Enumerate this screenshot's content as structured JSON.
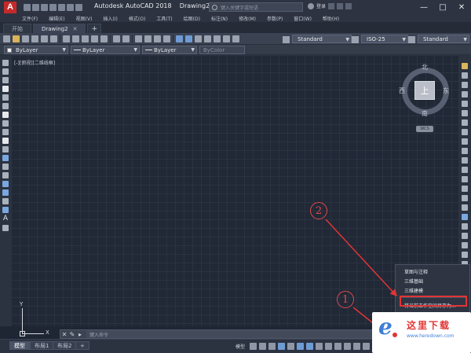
{
  "titlebar": {
    "app_name": "Autodesk AutoCAD 2018",
    "file_name": "Drawing2.dwg",
    "search_placeholder": "键入关键字或短语",
    "login_label": "登录",
    "logo_letter": "A"
  },
  "menu": {
    "items": [
      "文件(F)",
      "编辑(E)",
      "视图(V)",
      "插入(I)",
      "格式(O)",
      "工具(T)",
      "绘图(D)",
      "标注(N)",
      "修改(M)",
      "参数(P)",
      "窗口(W)",
      "帮助(H)"
    ],
    "window_controls": [
      "—",
      "□",
      "✕"
    ]
  },
  "tabs": {
    "start": "开始",
    "drawing": "Drawing2",
    "close_glyph": "✕",
    "new_tab_glyph": "+"
  },
  "toolbar": {
    "text_style": "Standard",
    "dim_style": "ISO-25",
    "table_style": "Standard"
  },
  "layerbar": {
    "color": "ByLayer",
    "linetype": "ByLayer",
    "lineweight": "ByLayer",
    "plotstyle": "ByColor"
  },
  "viewport": {
    "label": "[-][俯视][二维线框]"
  },
  "viewcube": {
    "north": "北",
    "south": "南",
    "east": "东",
    "west": "西",
    "face": "上",
    "wcs": "WCS"
  },
  "ucs": {
    "x": "X",
    "y": "Y"
  },
  "command": {
    "placeholder": "键入命令"
  },
  "statusbar": {
    "layout_tabs": [
      "模型",
      "布局1",
      "布局2"
    ],
    "plus": "+",
    "model_label": "模型"
  },
  "context_menu": {
    "items": [
      "草图与注释",
      "三维基础",
      "三维建模",
      "将当前工作空间另存为...",
      "工作空间设置..."
    ]
  },
  "annotations": {
    "marker_1": "1",
    "marker_2": "2",
    "highlight_color": "#e03535"
  },
  "watermark": {
    "title": "这里下载",
    "url": "www.heredown.com"
  }
}
